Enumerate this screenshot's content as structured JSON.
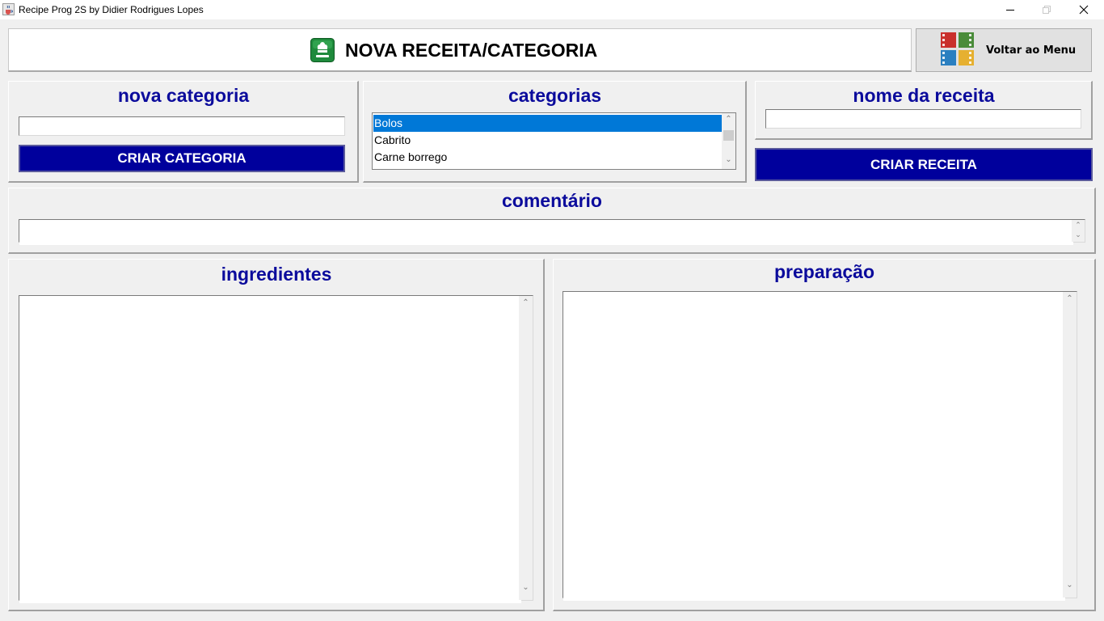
{
  "window": {
    "title": "Recipe Prog 2S by Didier Rodrigues Lopes",
    "icon": "java-cup-icon"
  },
  "header": {
    "title": "NOVA RECEITA/CATEGORIA",
    "icon": "chef-hat-icon",
    "menu_button_label": "Voltar ao Menu",
    "menu_button_icon": "menu-grid-icon"
  },
  "nova_categoria": {
    "title": "nova categoria",
    "input_value": "",
    "button_label": "CRIAR CATEGORIA"
  },
  "categorias": {
    "title": "categorias",
    "items": [
      "Bolos",
      "Cabrito",
      "Carne borrego"
    ],
    "selected": "Bolos"
  },
  "nome_receita": {
    "title": "nome da receita",
    "input_value": "",
    "button_label": "CRIAR RECEITA"
  },
  "comentario": {
    "title": "comentário",
    "value": ""
  },
  "ingredientes": {
    "title": "ingredientes",
    "value": ""
  },
  "preparacao": {
    "title": "preparação",
    "value": ""
  },
  "colors": {
    "title_blue": "#0b0b9c",
    "button_blue": "#00009c",
    "selection_blue": "#0078d7"
  }
}
